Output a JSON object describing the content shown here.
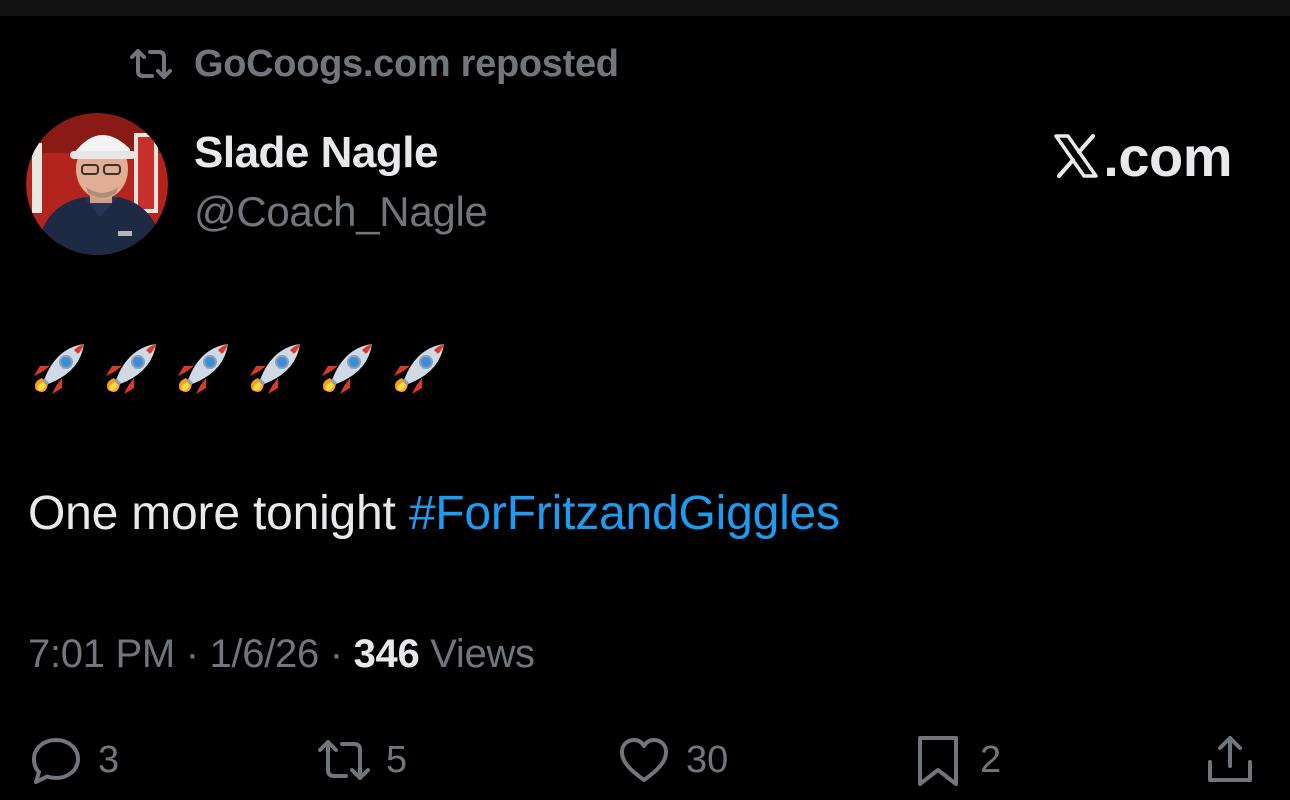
{
  "repost_banner": {
    "text": "GoCoogs.com reposted",
    "icon": "repost-icon"
  },
  "author": {
    "display_name": "Slade Nagle",
    "handle": "@Coach_Nagle",
    "avatar": "avatar-photo"
  },
  "brand": {
    "text": ".com",
    "logo": "x-logo-icon"
  },
  "tweet": {
    "emoji_line": [
      "rocket",
      "rocket",
      "rocket",
      "rocket",
      "rocket",
      "rocket"
    ],
    "text": "One more tonight ",
    "hashtag": "#ForFritzandGiggles"
  },
  "meta": {
    "time": "7:01 PM",
    "sep1": " · ",
    "date": "1/6/26",
    "sep2": " · ",
    "views_count": "346",
    "views_label": " Views"
  },
  "actions": {
    "replies": "3",
    "reposts": "5",
    "likes": "30",
    "bookmarks": "2"
  },
  "colors": {
    "background": "#000000",
    "primary_text": "#e7e9ea",
    "secondary_text": "#71767b",
    "link": "#1d9bf0"
  }
}
